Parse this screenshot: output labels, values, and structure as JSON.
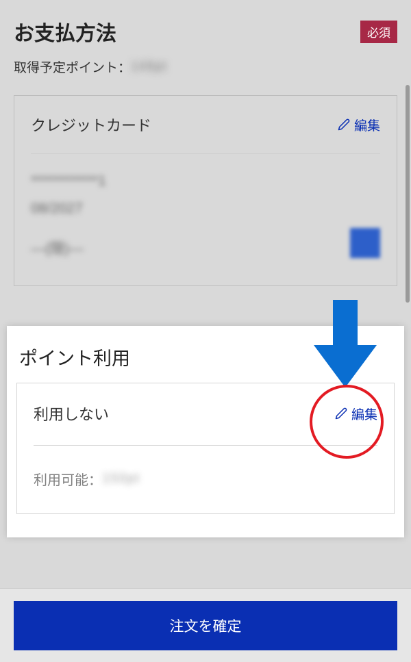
{
  "payment": {
    "title": "お支払方法",
    "required_label": "必須",
    "points_preview_label": "取得予定ポイント：",
    "points_preview_value": "149pt",
    "card": {
      "title": "クレジットカード",
      "edit_label": "編集",
      "masked_number": "************1",
      "expiry": "08/2027",
      "holder": "—(隠)—"
    }
  },
  "points": {
    "section_title": "ポイント利用",
    "status": "利用しない",
    "edit_label": "編集",
    "available_label": "利用可能：",
    "available_value": "150pt"
  },
  "confirm_label": "注文を確定",
  "colors": {
    "accent": "#0a2fb3",
    "highlight": "#e31b23",
    "badge": "#a72846"
  }
}
